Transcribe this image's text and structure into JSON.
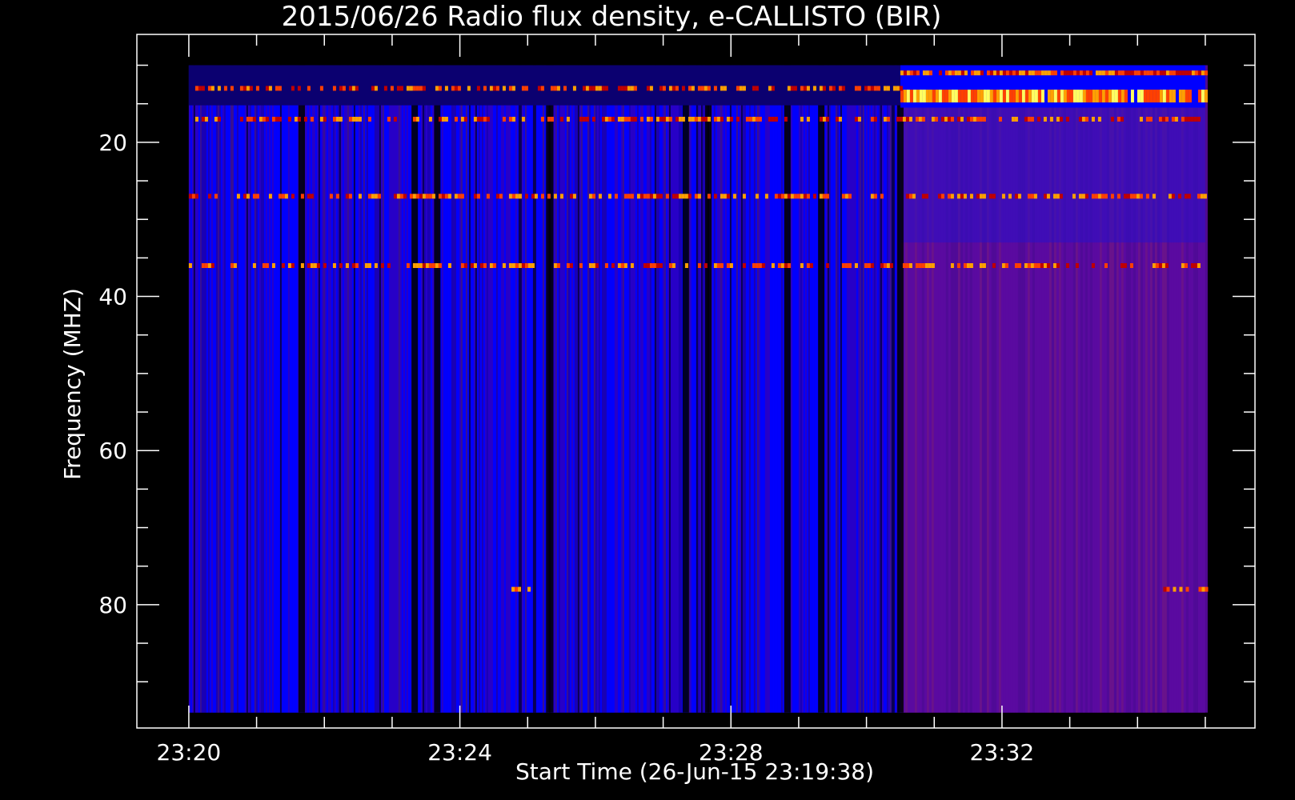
{
  "chart_data": {
    "type": "heatmap",
    "title": "2015/06/26  Radio flux density, e-CALLISTO (BIR)",
    "xlabel": "Start Time (26-Jun-15 23:19:38)",
    "ylabel": "Frequency (MHZ)",
    "start_time": "23:19:38",
    "x_unit": "time (HH:MM)",
    "y_unit": "MHz",
    "xlim": [
      "23:19:14",
      "23:35:44"
    ],
    "ylim": [
      96,
      6
    ],
    "data_xrange": [
      "23:20:00",
      "23:35:00"
    ],
    "data_yrange": [
      10,
      94
    ],
    "x_ticks": [
      "23:20",
      "23:24",
      "23:28",
      "23:32"
    ],
    "x_minor_ticks": [
      "23:21",
      "23:22",
      "23:23",
      "23:25",
      "23:26",
      "23:27",
      "23:29",
      "23:30",
      "23:31",
      "23:33",
      "23:34",
      "23:35"
    ],
    "y_ticks": [
      20,
      40,
      60,
      80
    ],
    "y_minor_ticks": [
      10,
      15,
      25,
      30,
      35,
      45,
      50,
      55,
      65,
      70,
      75,
      85,
      90
    ],
    "colormap": [
      "#000000",
      "#1a00b4",
      "#0000ff",
      "#5a0aa0",
      "#7a1a8a",
      "#c00000",
      "#ff4000",
      "#ffa000",
      "#ffff60"
    ],
    "regime_change_time": "23:30:30",
    "bright_bands": [
      {
        "freq": 11,
        "time_start": "23:30:30",
        "time_end": "23:35:00",
        "level": "high"
      },
      {
        "freq": 14,
        "time_start": "23:30:30",
        "time_end": "23:35:00",
        "level": "very-high"
      },
      {
        "freq": 13,
        "time_start": "23:20:00",
        "time_end": "23:30:30",
        "level": "medium"
      },
      {
        "freq": 17,
        "time_start": "23:20:00",
        "time_end": "23:35:00",
        "level": "medium"
      },
      {
        "freq": 27,
        "time_start": "23:20:00",
        "time_end": "23:35:00",
        "level": "medium"
      },
      {
        "freq": 36,
        "time_start": "23:20:00",
        "time_end": "23:35:00",
        "level": "medium"
      },
      {
        "freq": 78,
        "time_start": "23:24:40",
        "time_end": "23:25:00",
        "level": "medium"
      },
      {
        "freq": 78,
        "time_start": "23:34:20",
        "time_end": "23:35:00",
        "level": "medium"
      }
    ],
    "dark_columns": [
      "23:21:40",
      "23:23:20",
      "23:23:40",
      "23:25:20",
      "23:27:20",
      "23:27:40",
      "23:28:50",
      "23:29:20",
      "23:30:30"
    ],
    "grid": false,
    "legend": "none"
  }
}
